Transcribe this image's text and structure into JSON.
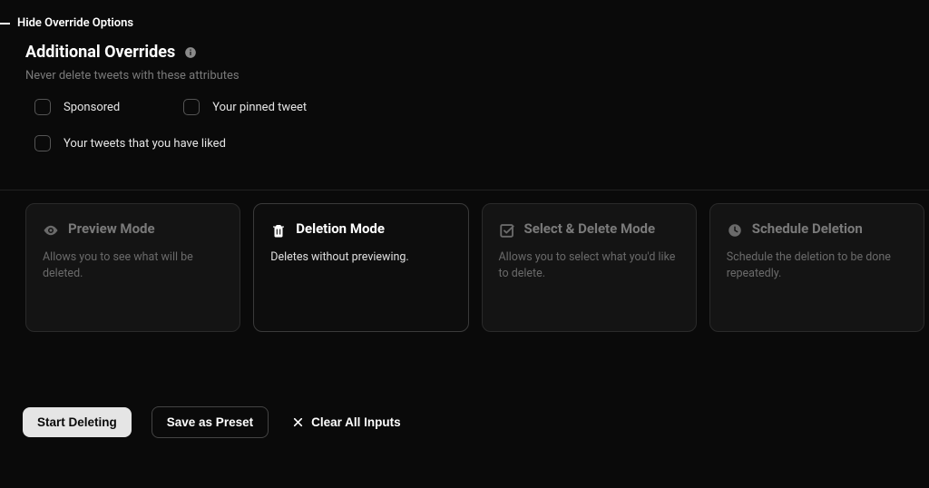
{
  "toggle": {
    "label": "Hide Override Options"
  },
  "overrides": {
    "title": "Additional Overrides",
    "subtitle": "Never delete tweets with these attributes",
    "checkboxes": {
      "sponsored": "Sponsored",
      "pinned": "Your pinned tweet",
      "liked": "Your tweets that you have liked"
    }
  },
  "modes": {
    "preview": {
      "title": "Preview Mode",
      "desc": "Allows you to see what will be deleted."
    },
    "deletion": {
      "title": "Deletion Mode",
      "desc": "Deletes without previewing."
    },
    "select_delete": {
      "title": "Select & Delete Mode",
      "desc": "Allows you to select what you'd like to delete."
    },
    "schedule": {
      "title": "Schedule Deletion",
      "desc": "Schedule the deletion to be done repeatedly."
    }
  },
  "actions": {
    "start": "Start Deleting",
    "save_preset": "Save as Preset",
    "clear": "Clear All Inputs"
  }
}
